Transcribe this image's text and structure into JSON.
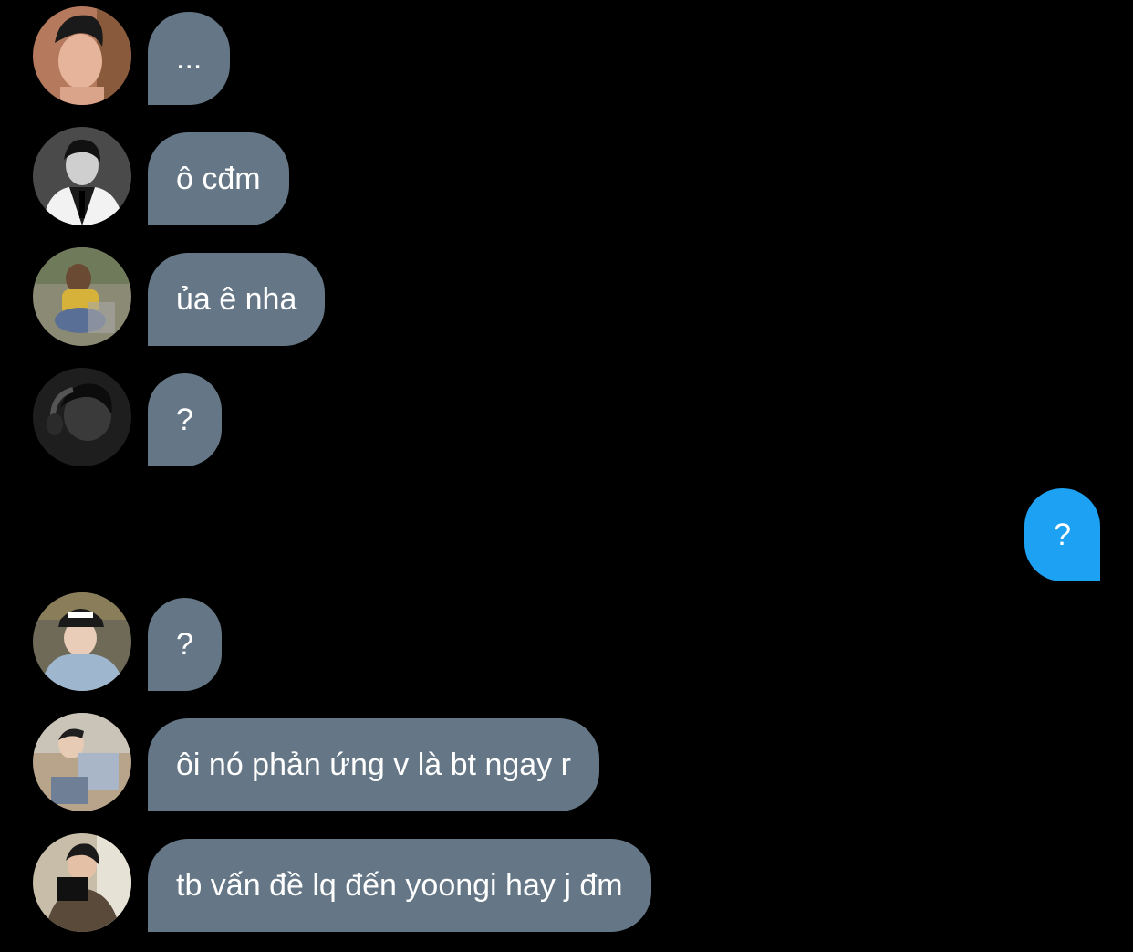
{
  "colors": {
    "background": "#000000",
    "incoming_bubble": "#657786",
    "outgoing_bubble": "#1da1f2",
    "bubble_text": "#ffffff"
  },
  "messages": [
    {
      "direction": "incoming",
      "text": "...",
      "avatar": "avatar-photo"
    },
    {
      "direction": "incoming",
      "text": "ô cđm",
      "avatar": "avatar-photo"
    },
    {
      "direction": "incoming",
      "text": "ủa ê nha",
      "avatar": "avatar-photo"
    },
    {
      "direction": "incoming",
      "text": "?",
      "avatar": "avatar-photo"
    },
    {
      "direction": "outgoing",
      "text": "?"
    },
    {
      "direction": "incoming",
      "text": "?",
      "avatar": "avatar-photo"
    },
    {
      "direction": "incoming",
      "text": "ôi nó phản ứng v là bt ngay r",
      "avatar": "avatar-photo"
    },
    {
      "direction": "incoming",
      "text": "tb vấn đề lq đến yoongi hay j đm",
      "avatar": "avatar-photo"
    }
  ]
}
